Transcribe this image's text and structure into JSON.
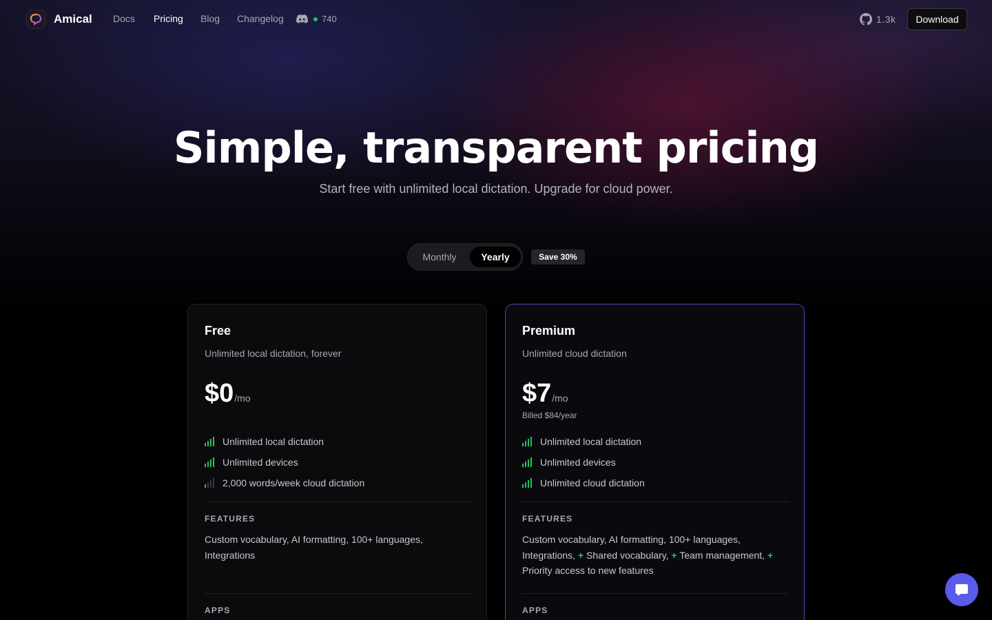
{
  "nav": {
    "brand": "Amical",
    "links": [
      "Docs",
      "Pricing",
      "Blog",
      "Changelog"
    ],
    "discord_count": "740",
    "github_stars": "1.3k",
    "download_label": "Download"
  },
  "hero": {
    "title": "Simple, transparent pricing",
    "subtitle": "Start free with unlimited local dictation. Upgrade for cloud power."
  },
  "billing": {
    "options": [
      "Monthly",
      "Yearly"
    ],
    "selected": "Yearly",
    "badge": "Save 30%"
  },
  "plans": [
    {
      "name": "Free",
      "description": "Unlimited local dictation, forever",
      "price": "$0",
      "unit": "/mo",
      "billed": "",
      "limits": [
        "Unlimited local dictation",
        "Unlimited devices",
        "2,000 words/week cloud dictation"
      ],
      "features_label": "FEATURES",
      "features": "Custom vocabulary, AI formatting, 100+ languages, Integrations",
      "apps_label": "APPS"
    },
    {
      "name": "Premium",
      "description": "Unlimited cloud dictation",
      "price": "$7",
      "unit": "/mo",
      "billed": "Billed $84/year",
      "limits": [
        "Unlimited local dictation",
        "Unlimited devices",
        "Unlimited cloud dictation"
      ],
      "features_label": "FEATURES",
      "features_base": "Custom vocabulary, AI formatting, 100+ languages, Integrations,",
      "features_extra": [
        "Shared vocabulary,",
        "Team management,",
        "Priority access to new features"
      ],
      "apps_label": "APPS"
    }
  ],
  "colors": {
    "accent_green": "#22c55e",
    "premium_border": "#4b4bb8",
    "chat_button": "#5b5bea"
  }
}
